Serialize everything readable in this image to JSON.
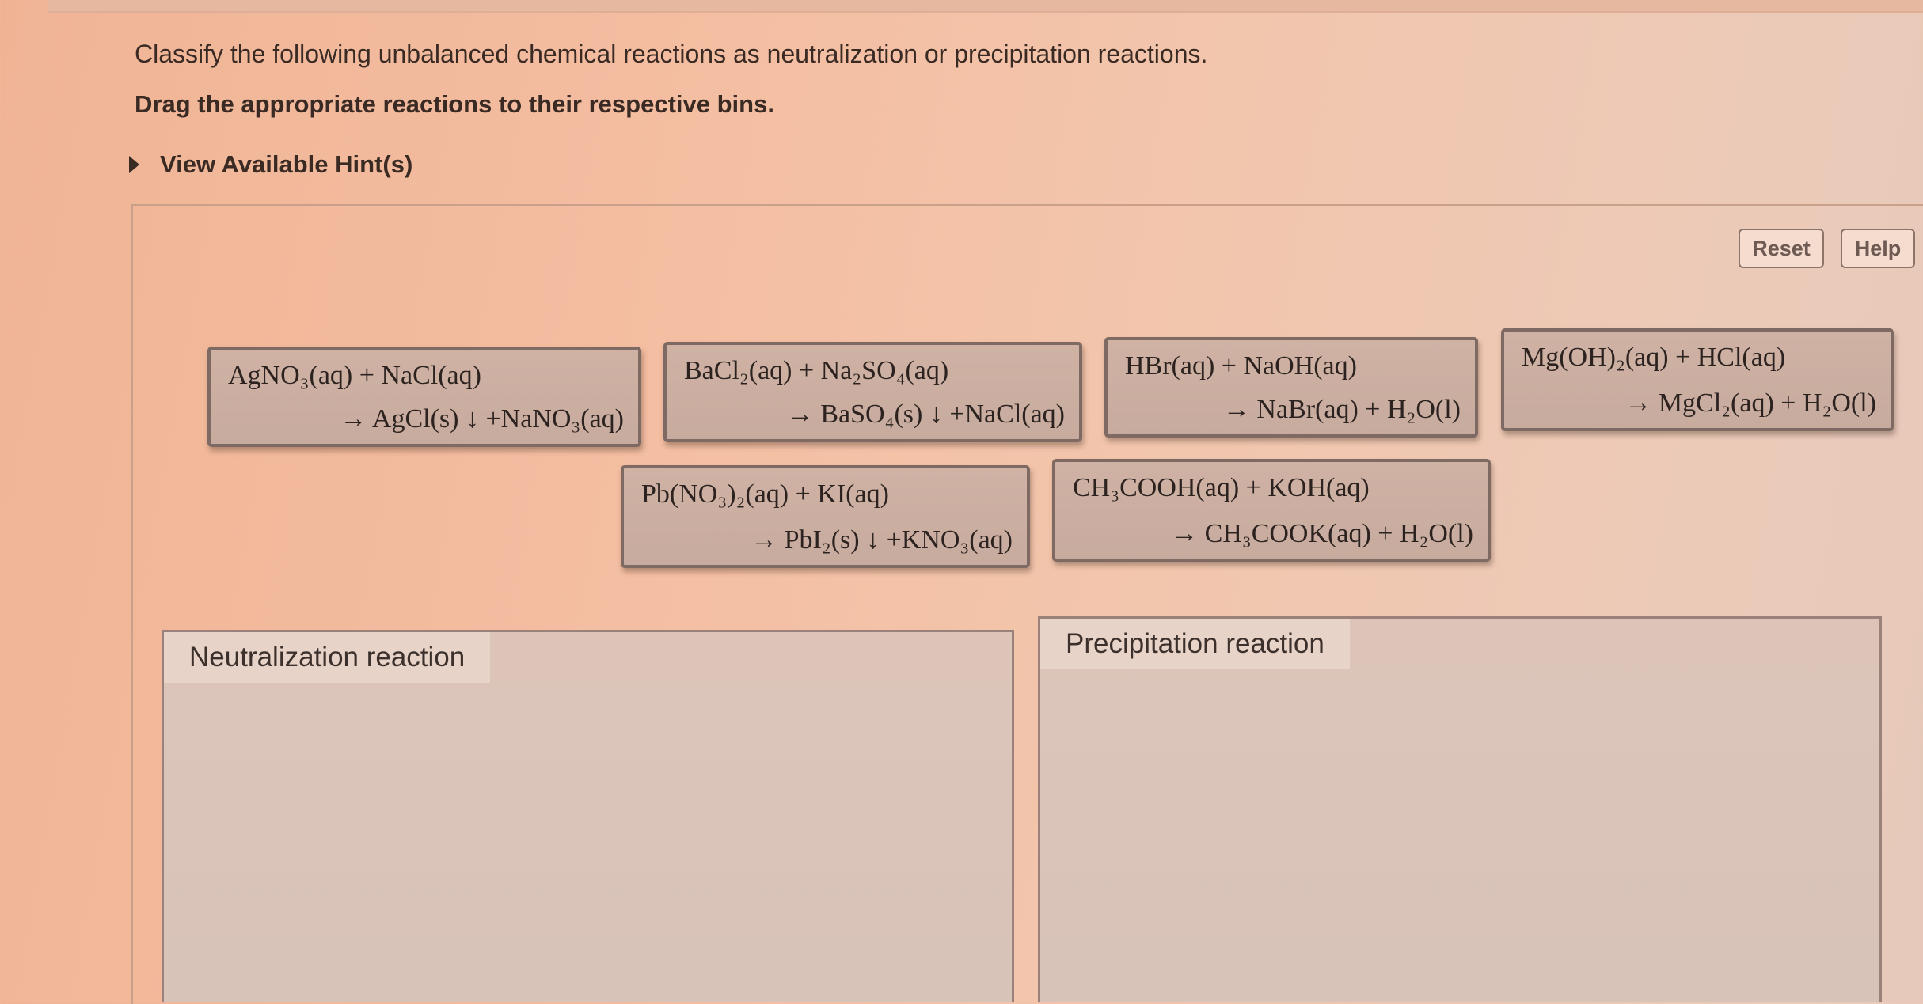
{
  "question": {
    "prompt": "Classify the following unbalanced chemical reactions as neutralization or precipitation reactions.",
    "instruction": "Drag the appropriate reactions to their respective bins.",
    "hint_label": "View Available Hint(s)"
  },
  "toolbar": {
    "reset_label": "Reset",
    "help_label": "Help"
  },
  "reactions": [
    {
      "reactants": "AgNO₃(aq) + NaCl(aq)",
      "products": "→ AgCl(s) ↓ +NaNO₃(aq)"
    },
    {
      "reactants": "BaCl₂(aq) + Na₂SO₄(aq)",
      "products": "→ BaSO₄(s) ↓ +NaCl(aq)"
    },
    {
      "reactants": "HBr(aq) + NaOH(aq)",
      "products": "→ NaBr(aq) + H₂O(l)"
    },
    {
      "reactants": "Mg(OH)₂(aq) + HCl(aq)",
      "products": "→ MgCl₂(aq) + H₂O(l)"
    },
    {
      "reactants": "Pb(NO₃)₂(aq) + KI(aq)",
      "products": "→ PbI₂(s) ↓ +KNO₃(aq)"
    },
    {
      "reactants": "CH₃COOH(aq) + KOH(aq)",
      "products": "→ CH₃COOK(aq) + H₂O(l)"
    }
  ],
  "bins": [
    {
      "label": "Neutralization reaction"
    },
    {
      "label": "Precipitation reaction"
    }
  ]
}
